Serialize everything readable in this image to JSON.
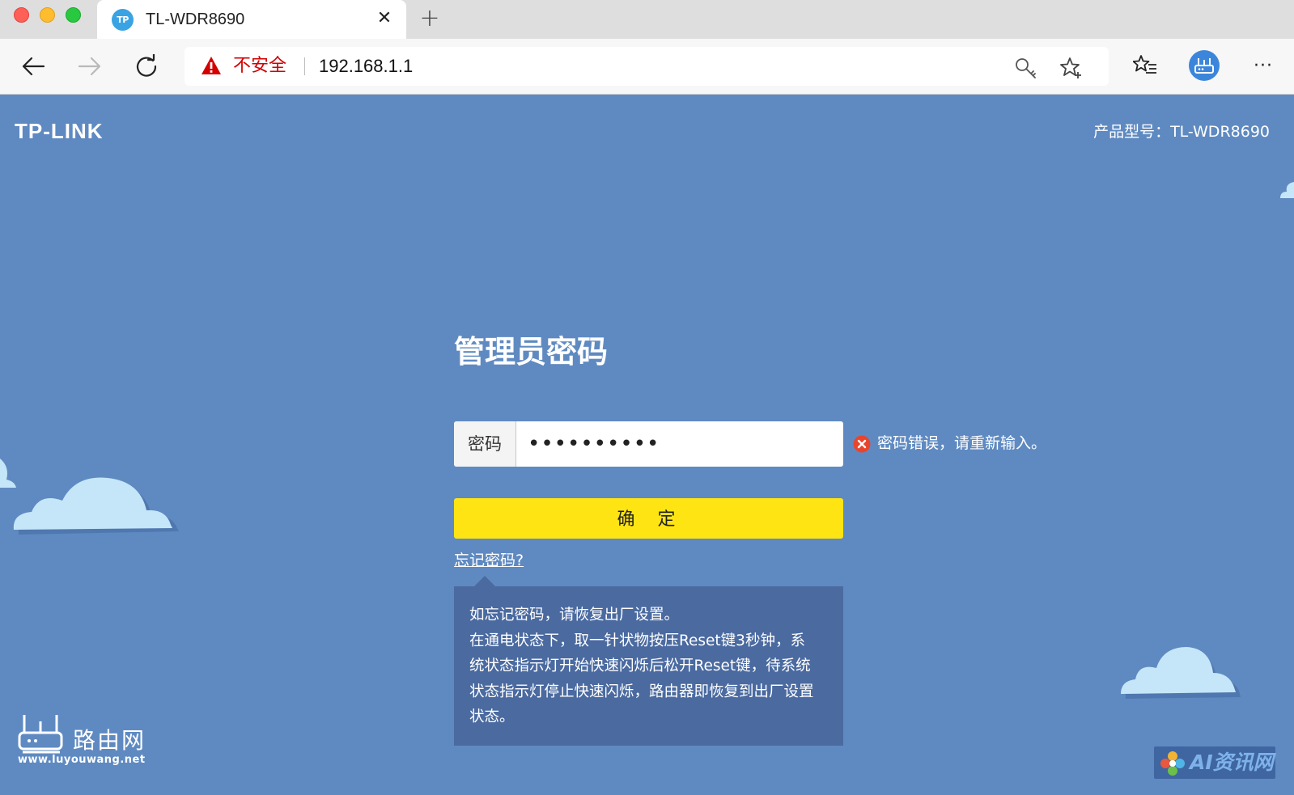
{
  "browser": {
    "tab_title": "TL-WDR8690",
    "favicon_text": "TP",
    "insecure_label": "不安全",
    "url": "192.168.1.1",
    "close_symbol": "✕",
    "new_tab_symbol": "+",
    "more_symbol": "···"
  },
  "header": {
    "logo": "TP-LINK",
    "model_label": "产品型号：TL-WDR8690"
  },
  "login": {
    "title": "管理员密码",
    "password_label": "密码",
    "password_value": "••••••••••",
    "error_message": "密码错误，请重新输入。",
    "confirm_label": "确定",
    "forgot_link": "忘记密码?",
    "tip_lines": [
      "如忘记密码，请恢复出厂设置。",
      "在通电状态下，取一针状物按压Reset键3秒钟，系",
      "统状态指示灯开始快速闪烁后松开Reset键，待系统",
      "状态指示灯停止快速闪烁，路由器即恢复到出厂设置",
      "状态。"
    ]
  },
  "watermarks": {
    "left_name": "路由网",
    "left_url": "www.luyouwang.net",
    "right_name": "AI资讯网"
  },
  "colors": {
    "page_bg": "#5f8ac1",
    "button": "#ffe414",
    "tip_bg": "#4a6aa0",
    "cloud": "#c5e6f8",
    "error": "#e8452c",
    "insecure": "#d40000"
  },
  "icons": {
    "back": "arrow-left-icon",
    "forward": "arrow-right-icon",
    "reload": "reload-icon",
    "warning": "warning-triangle-icon",
    "key": "key-icon",
    "star": "add-favorite-star-icon",
    "favorites": "favorites-list-icon",
    "profile": "router-profile-icon",
    "error": "error-x-circle-icon"
  }
}
